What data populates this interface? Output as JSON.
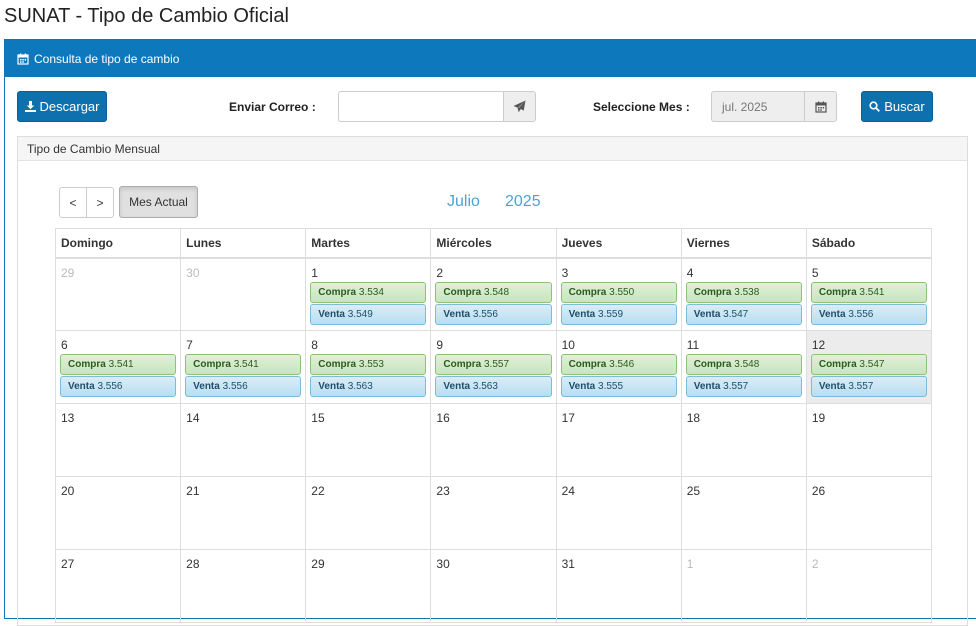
{
  "page": {
    "title": "SUNAT - Tipo de Cambio Oficial"
  },
  "panel": {
    "heading": "Consulta de tipo de cambio"
  },
  "toolbar": {
    "download_label": "Descargar",
    "email_label": "Enviar Correo :",
    "email_value": "",
    "month_label": "Seleccione Mes :",
    "month_value": "jul. 2025",
    "search_label": "Buscar"
  },
  "calendar": {
    "heading": "Tipo de Cambio Mensual",
    "prev_label": "<",
    "next_label": ">",
    "current_month_label": "Mes Actual",
    "month": "Julio",
    "year": "2025",
    "weekdays": [
      "Domingo",
      "Lunes",
      "Martes",
      "Miércoles",
      "Jueves",
      "Viernes",
      "Sábado"
    ],
    "compra_label": "Compra",
    "venta_label": "Venta",
    "weeks": [
      [
        {
          "day": "29",
          "muted": true
        },
        {
          "day": "30",
          "muted": true
        },
        {
          "day": "1",
          "compra": "3.534",
          "venta": "3.549"
        },
        {
          "day": "2",
          "compra": "3.548",
          "venta": "3.556"
        },
        {
          "day": "3",
          "compra": "3.550",
          "venta": "3.559"
        },
        {
          "day": "4",
          "compra": "3.538",
          "venta": "3.547"
        },
        {
          "day": "5",
          "compra": "3.541",
          "venta": "3.556"
        }
      ],
      [
        {
          "day": "6",
          "compra": "3.541",
          "venta": "3.556"
        },
        {
          "day": "7",
          "compra": "3.541",
          "venta": "3.556"
        },
        {
          "day": "8",
          "compra": "3.553",
          "venta": "3.563"
        },
        {
          "day": "9",
          "compra": "3.557",
          "venta": "3.563"
        },
        {
          "day": "10",
          "compra": "3.546",
          "venta": "3.555"
        },
        {
          "day": "11",
          "compra": "3.548",
          "venta": "3.557"
        },
        {
          "day": "12",
          "compra": "3.547",
          "venta": "3.557",
          "today": true
        }
      ],
      [
        {
          "day": "13"
        },
        {
          "day": "14"
        },
        {
          "day": "15"
        },
        {
          "day": "16"
        },
        {
          "day": "17"
        },
        {
          "day": "18"
        },
        {
          "day": "19"
        }
      ],
      [
        {
          "day": "20"
        },
        {
          "day": "21"
        },
        {
          "day": "22"
        },
        {
          "day": "23"
        },
        {
          "day": "24"
        },
        {
          "day": "25"
        },
        {
          "day": "26"
        }
      ],
      [
        {
          "day": "27"
        },
        {
          "day": "28"
        },
        {
          "day": "29"
        },
        {
          "day": "30"
        },
        {
          "day": "31"
        },
        {
          "day": "1",
          "muted": true
        },
        {
          "day": "2",
          "muted": true
        }
      ]
    ]
  },
  "colors": {
    "header_blue": "#0d79bc",
    "button_blue": "#0d71ad",
    "calendar_title": "#4aa3d8",
    "compra_bg": "#dff0d8",
    "venta_bg": "#d9edf7",
    "today_bg": "#ececec"
  },
  "icons": {
    "panel": "calendar-icon",
    "download": "download-icon",
    "send": "paper-plane-icon",
    "month_picker": "calendar-icon",
    "search": "search-icon"
  }
}
